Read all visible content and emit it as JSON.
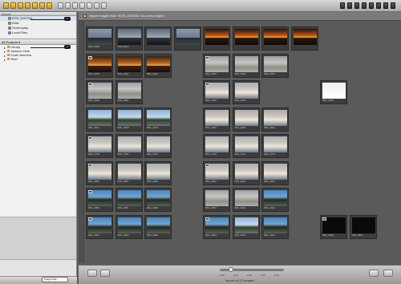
{
  "toolbar": {
    "left_buttons": [
      "folder-icon",
      "import-icon",
      "album-icon",
      "book-icon",
      "light-table-icon",
      "web-icon",
      "share-icon"
    ],
    "grey_buttons": [
      "rotate-left-icon",
      "rotate-right-icon",
      "compare-icon",
      "stack-icon",
      "pick-icon",
      "extract-icon",
      "view-icon"
    ]
  },
  "import_panel": {
    "title": "Import",
    "items": [
      {
        "label": "EOS_DIGITAL"
      },
      {
        "label": "iDisk"
      },
      {
        "label": "Screenplay"
      },
      {
        "label": "Local Files"
      }
    ]
  },
  "projects_panel": {
    "title": "All Projects ▾",
    "items": [
      {
        "label": "Library"
      },
      {
        "label": "Jackson Hole"
      },
      {
        "label": "South America"
      },
      {
        "label": "Tibet"
      }
    ]
  },
  "badges": {
    "one": "1",
    "two": "2"
  },
  "browser": {
    "import_checkbox_label": "Import images from “EOS_DIGITAL” to a new project",
    "thumbs": [
      {
        "row": 0,
        "col": 0,
        "style": "sky",
        "caption": "IMG_0006",
        "stack": ""
      },
      {
        "row": 0,
        "col": 1,
        "style": "dusk",
        "caption": "IMG_0012",
        "stack": ""
      },
      {
        "row": 0,
        "col": 2,
        "style": "dusk",
        "caption": "",
        "stack": ""
      },
      {
        "row": 0,
        "col": 3,
        "style": "sky",
        "caption": "",
        "stack": ""
      },
      {
        "row": 0,
        "col": 4,
        "style": "sunset",
        "caption": "",
        "stack": ""
      },
      {
        "row": 0,
        "col": 5,
        "style": "sunset",
        "caption": "",
        "stack": ""
      },
      {
        "row": 0,
        "col": 6,
        "style": "sunset",
        "caption": "",
        "stack": ""
      },
      {
        "row": 0,
        "col": 7,
        "style": "sunset",
        "caption": "",
        "stack": ""
      },
      {
        "row": 1,
        "col": 0,
        "style": "sunset2",
        "caption": "IMG_2010",
        "stack": "6"
      },
      {
        "row": 1,
        "col": 1,
        "style": "sunset2",
        "caption": "IMG_2011",
        "stack": ""
      },
      {
        "row": 1,
        "col": 2,
        "style": "sunset2",
        "caption": "IMG_2012",
        "stack": ""
      },
      {
        "row": 1,
        "col": 4,
        "style": "hazy",
        "caption": "IMG_2020",
        "stack": "3"
      },
      {
        "row": 1,
        "col": 5,
        "style": "hazy",
        "caption": "IMG_2021",
        "stack": ""
      },
      {
        "row": 1,
        "col": 6,
        "style": "hazy",
        "caption": "IMG_2022",
        "stack": ""
      },
      {
        "row": 2,
        "col": 0,
        "style": "hazy",
        "caption": "IMG_2030",
        "stack": "2"
      },
      {
        "row": 2,
        "col": 1,
        "style": "hazy",
        "caption": "IMG_2031",
        "stack": ""
      },
      {
        "row": 2,
        "col": 4,
        "style": "bldg",
        "caption": "IMG_2040",
        "stack": "2"
      },
      {
        "row": 2,
        "col": 5,
        "style": "bldg",
        "caption": "IMG_2041",
        "stack": ""
      },
      {
        "row": 2,
        "col": 8,
        "style": "white",
        "caption": "IMG_3000",
        "stack": ""
      },
      {
        "row": 3,
        "col": 0,
        "style": "beach",
        "caption": "IMG_2617",
        "stack": ""
      },
      {
        "row": 3,
        "col": 1,
        "style": "beach",
        "caption": "IMG_2618",
        "stack": ""
      },
      {
        "row": 3,
        "col": 2,
        "style": "beach",
        "caption": "IMG_2619",
        "stack": ""
      },
      {
        "row": 3,
        "col": 4,
        "style": "bldg",
        "caption": "IMG_2620",
        "stack": ""
      },
      {
        "row": 3,
        "col": 5,
        "style": "bldg",
        "caption": "IMG_2621",
        "stack": ""
      },
      {
        "row": 3,
        "col": 6,
        "style": "bldg",
        "caption": "IMG_2622",
        "stack": ""
      },
      {
        "row": 4,
        "col": 0,
        "style": "bldg",
        "caption": "IMG_2700",
        "stack": "4"
      },
      {
        "row": 4,
        "col": 1,
        "style": "bldg",
        "caption": "IMG_2701",
        "stack": ""
      },
      {
        "row": 4,
        "col": 2,
        "style": "bldg",
        "caption": "IMG_2702",
        "stack": ""
      },
      {
        "row": 4,
        "col": 4,
        "style": "bldg",
        "caption": "IMG_2710",
        "stack": ""
      },
      {
        "row": 4,
        "col": 5,
        "style": "bldg",
        "caption": "IMG_2711",
        "stack": ""
      },
      {
        "row": 4,
        "col": 6,
        "style": "bldg",
        "caption": "IMG_2712",
        "stack": ""
      },
      {
        "row": 5,
        "col": 0,
        "style": "bldg",
        "caption": "IMG_2800",
        "stack": "3"
      },
      {
        "row": 5,
        "col": 1,
        "style": "bldg",
        "caption": "IMG_2801",
        "stack": ""
      },
      {
        "row": 5,
        "col": 2,
        "style": "bldg",
        "caption": "IMG_2802",
        "stack": ""
      },
      {
        "row": 5,
        "col": 4,
        "style": "bldg",
        "caption": "IMG_2810",
        "stack": "4"
      },
      {
        "row": 5,
        "col": 5,
        "style": "bldg",
        "caption": "IMG_2811",
        "stack": ""
      },
      {
        "row": 5,
        "col": 6,
        "style": "bldg",
        "caption": "IMG_2812",
        "stack": ""
      },
      {
        "row": 6,
        "col": 0,
        "style": "palms",
        "caption": "IMG_2900",
        "stack": "4"
      },
      {
        "row": 6,
        "col": 1,
        "style": "palms",
        "caption": "IMG_2901",
        "stack": ""
      },
      {
        "row": 6,
        "col": 2,
        "style": "palms",
        "caption": "IMG_2902",
        "stack": ""
      },
      {
        "row": 6,
        "col": 4,
        "style": "hazy",
        "caption": "IMG_2910",
        "stack": ""
      },
      {
        "row": 6,
        "col": 5,
        "style": "hazy",
        "caption": "IMG_2911",
        "stack": ""
      },
      {
        "row": 6,
        "col": 6,
        "style": "palms",
        "caption": "IMG_2912",
        "stack": ""
      },
      {
        "row": 7,
        "col": 0,
        "style": "palms",
        "caption": "IMG_3001",
        "stack": "2"
      },
      {
        "row": 7,
        "col": 1,
        "style": "palms",
        "caption": "IMG_3002",
        "stack": ""
      },
      {
        "row": 7,
        "col": 2,
        "style": "palms",
        "caption": "IMG_3003",
        "stack": ""
      },
      {
        "row": 7,
        "col": 4,
        "style": "palms",
        "caption": "IMG_3010",
        "stack": "3"
      },
      {
        "row": 7,
        "col": 5,
        "style": "beach",
        "caption": "IMG_3011",
        "stack": ""
      },
      {
        "row": 7,
        "col": 6,
        "style": "palms",
        "caption": "IMG_3012",
        "stack": ""
      },
      {
        "row": 7,
        "col": 8,
        "style": "dark",
        "caption": "IMG_3020",
        "stack": "2"
      },
      {
        "row": 7,
        "col": 9,
        "style": "dark",
        "caption": "IMG_3021",
        "stack": ""
      }
    ]
  },
  "bottombar": {
    "count_label": "Import all 22 images",
    "search_placeholder": "Image Date",
    "ticks": [
      "0.15",
      "0.15",
      "0.15",
      "0.15",
      "1.00"
    ]
  }
}
